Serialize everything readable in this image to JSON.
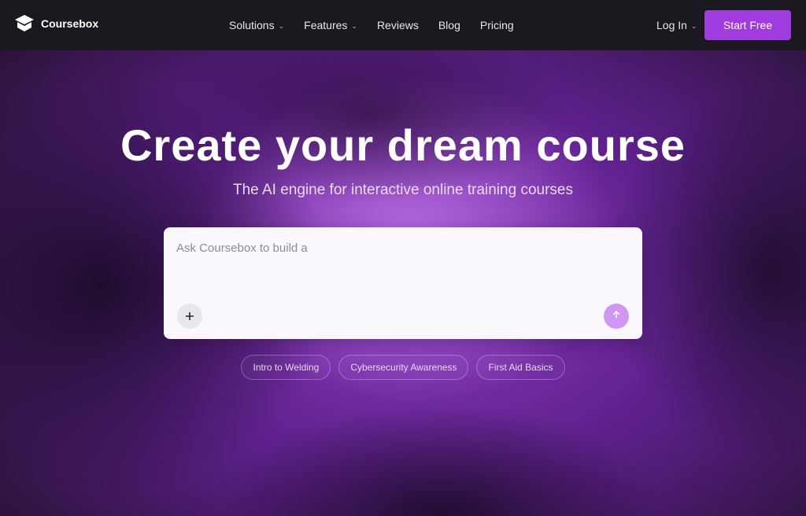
{
  "brand": {
    "name": "Coursebox",
    "logo_icon": "box-icon"
  },
  "nav": {
    "links": [
      {
        "label": "Solutions",
        "has_dropdown": true
      },
      {
        "label": "Features",
        "has_dropdown": true
      },
      {
        "label": "Reviews",
        "has_dropdown": false
      },
      {
        "label": "Blog",
        "has_dropdown": false
      },
      {
        "label": "Pricing",
        "has_dropdown": false
      }
    ],
    "login_label": "Log In",
    "cta_label": "Start Free"
  },
  "hero": {
    "title": "Create your dream course",
    "subtitle": "The AI engine for interactive online training courses",
    "prompt_placeholder": "Ask Coursebox to build a",
    "plus_icon": "plus-icon",
    "send_icon": "arrow-up-icon",
    "suggestions": [
      "Intro to Welding",
      "Cybersecurity Awareness",
      "First Aid Basics"
    ]
  },
  "colors": {
    "nav_bg": "#1c181f",
    "accent": "#a03bdf",
    "send_button": "#cf96f2",
    "hero_purple": "#8a37c2"
  }
}
